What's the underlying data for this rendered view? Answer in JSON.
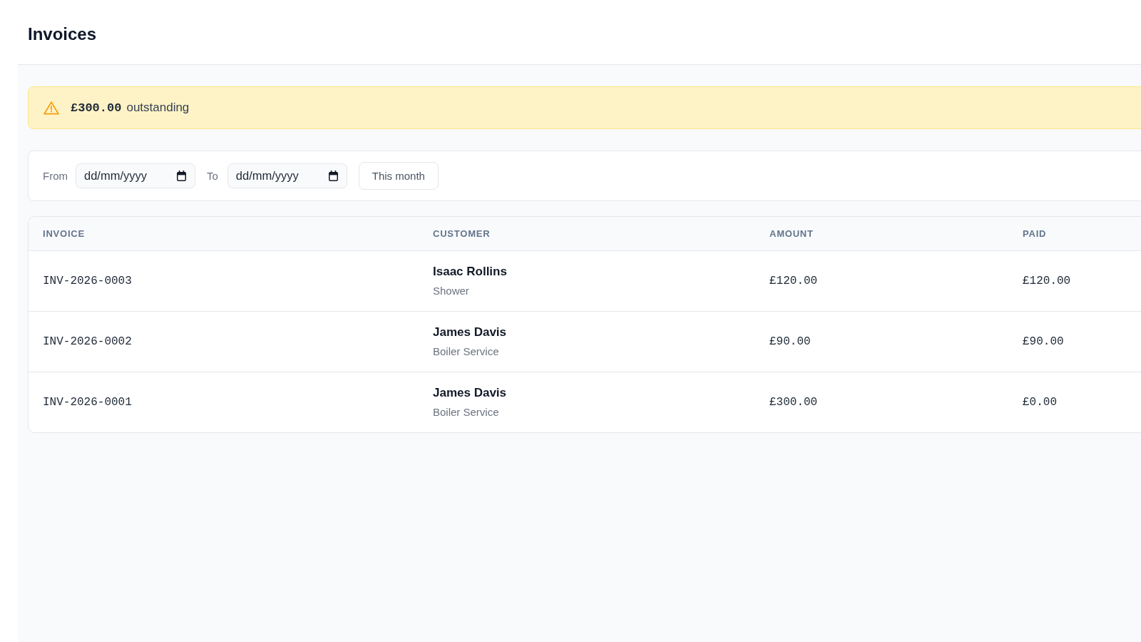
{
  "header": {
    "title": "Invoices"
  },
  "alert": {
    "kind": "warning",
    "amount": "£300.00",
    "label": "outstanding"
  },
  "filter": {
    "from_label": "From",
    "from_field": {
      "placeholder": "dd/mm/yyyy"
    },
    "to_label": "To",
    "to_field": {
      "placeholder": "dd/mm/yyyy"
    },
    "button": "This month"
  },
  "table": {
    "columns": [
      "INVOICE",
      "CUSTOMER",
      "AMOUNT",
      "PAID"
    ],
    "rows": [
      {
        "invoice": "INV-2026-0003",
        "customer": "Isaac Rollins",
        "service": "Shower",
        "amount": "£120.00",
        "paid": "£120.00"
      },
      {
        "invoice": "INV-2026-0002",
        "customer": "James Davis",
        "service": "Boiler Service",
        "amount": "£90.00",
        "paid": "£90.00"
      },
      {
        "invoice": "INV-2026-0001",
        "customer": "James Davis",
        "service": "Boiler Service",
        "amount": "£300.00",
        "paid": "£0.00"
      }
    ]
  }
}
